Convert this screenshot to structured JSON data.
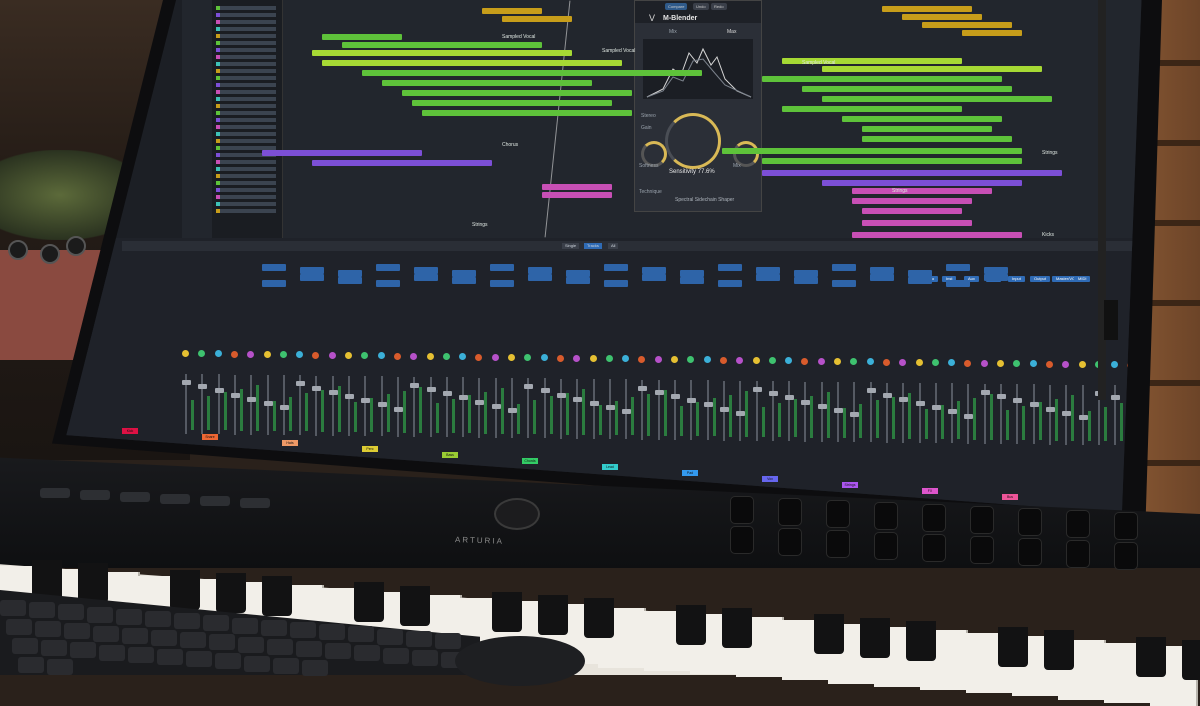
{
  "daw": {
    "plugin": {
      "name": "M-Blender",
      "buttons": [
        "Compare",
        "Undo",
        "Redo"
      ],
      "mix_label": "Mix",
      "mix_value": "Max",
      "label_left": "Stereo",
      "sensitivity_label": "Sensitivity",
      "sensitivity_value": "77.6%",
      "technique_label": "Technique",
      "footer": "Spectral Sidechain Shaper",
      "mix_small": "Mix",
      "knob_labels": [
        "Softness",
        "Gain",
        "Drive"
      ]
    },
    "arrange": {
      "region_labels": [
        "Sampled Vocal",
        "Sampled Vocal",
        "Chorus",
        "Strings",
        "Strings",
        "Kicks",
        "Sampled Vocal",
        "Strings"
      ]
    },
    "mixer": {
      "view_tabs": [
        "Single",
        "Tracks",
        "All"
      ],
      "view_buttons": [
        "Audio",
        "Inst",
        "Aux",
        "Bus",
        "Input",
        "Output",
        "Master/VCA",
        "MIDI"
      ],
      "bottom_names": [
        "Kick",
        "Snare",
        "Hats",
        "Perc",
        "Bass",
        "Chords",
        "Lead",
        "Pad",
        "Vox",
        "Strings",
        "FX",
        "Bus"
      ]
    }
  },
  "controller": {
    "brand": "ARTURIA"
  },
  "colors": {
    "region_green": "#5ec23a",
    "region_lime": "#a6d934",
    "region_yellow": "#c79d1a",
    "region_purple": "#7c4fd6",
    "region_pink": "#c84fb5",
    "accent_gold": "#d9b956",
    "button_blue": "#2f6bb5"
  },
  "icons": {
    "plugin_logo": "v-logo-icon",
    "playhead": "playhead-line"
  }
}
